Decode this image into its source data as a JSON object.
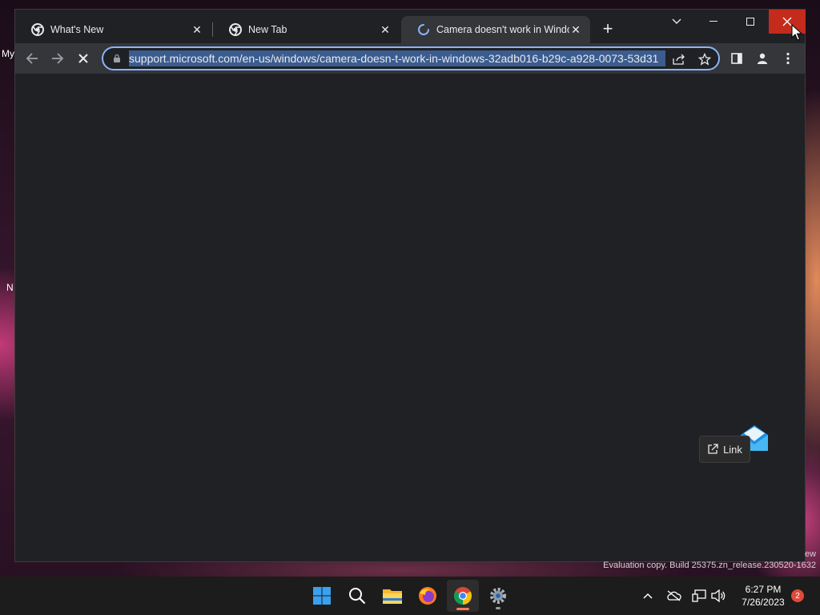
{
  "desktop": {
    "fragment_my": "My",
    "fragment_n": "N"
  },
  "browser": {
    "tabs": [
      {
        "title": "What's New",
        "favicon": "chrome-icon",
        "state": "inactive"
      },
      {
        "title": "New Tab",
        "favicon": "chrome-icon",
        "state": "inactive"
      },
      {
        "title": "Camera doesn't work in Windows",
        "favicon": "loading-spinner-icon",
        "state": "active"
      }
    ],
    "newtab_glyph": "+",
    "omnibox": {
      "url": "support.microsoft.com/en-us/windows/camera-doesn-t-work-in-windows-32adb016-b29c-a928-0073-53d31"
    },
    "link_chip_label": "Link"
  },
  "watermark": {
    "text": "Evaluation copy. Build 25375.zn_release.230520-1632",
    "edge_text": "ew"
  },
  "taskbar": {
    "apps": [
      "start-icon",
      "search-icon",
      "file-explorer-icon",
      "firefox-icon",
      "chrome-icon",
      "settings-icon"
    ],
    "clock_time": "6:27 PM",
    "clock_date": "7/26/2023",
    "notification_count": "2"
  },
  "colors": {
    "accent": "#8ab4f8",
    "titlebar_close": "#c42b1c",
    "active_app_indicator": "#f47a5c",
    "url_selection": "#3b5c8f"
  }
}
